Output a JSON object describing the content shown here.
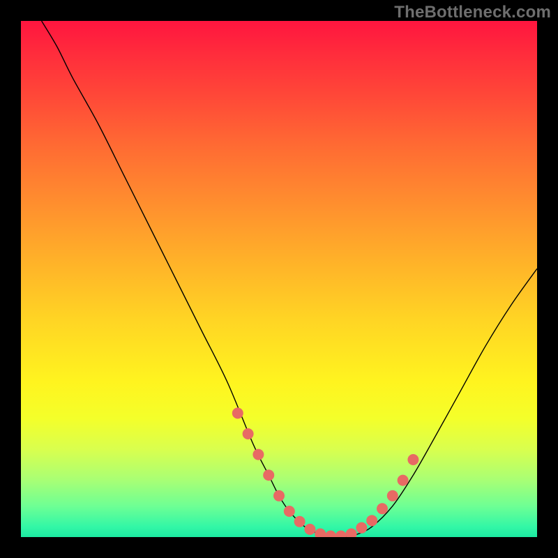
{
  "watermark": "TheBottleneck.com",
  "colors": {
    "background": "#000000",
    "dot": "#e86a64",
    "curve": "#000000",
    "gradient_top": "#ff153f",
    "gradient_bottom": "#1ceaa2"
  },
  "chart_data": {
    "type": "line",
    "title": "",
    "xlabel": "",
    "ylabel": "",
    "xlim": [
      0,
      100
    ],
    "ylim": [
      0,
      100
    ],
    "grid": false,
    "series": [
      {
        "name": "bottleneck-curve",
        "x": [
          4,
          7,
          10,
          15,
          20,
          25,
          30,
          35,
          40,
          45,
          48,
          50,
          52,
          55,
          58,
          60,
          62,
          65,
          68,
          72,
          76,
          80,
          85,
          90,
          95,
          100
        ],
        "y": [
          100,
          95,
          89,
          80,
          70,
          60,
          50,
          40,
          30,
          18,
          12,
          8,
          5,
          2,
          0.5,
          0,
          0,
          0.5,
          2,
          6,
          12,
          19,
          28,
          37,
          45,
          52
        ]
      }
    ],
    "highlight_points": {
      "name": "marked-range",
      "x": [
        42,
        44,
        46,
        48,
        50,
        52,
        54,
        56,
        58,
        60,
        62,
        64,
        66,
        68,
        70,
        72,
        74,
        76
      ],
      "y": [
        24,
        20,
        16,
        12,
        8,
        5,
        3,
        1.5,
        0.6,
        0.2,
        0.2,
        0.6,
        1.8,
        3.2,
        5.5,
        8,
        11,
        15
      ]
    }
  }
}
